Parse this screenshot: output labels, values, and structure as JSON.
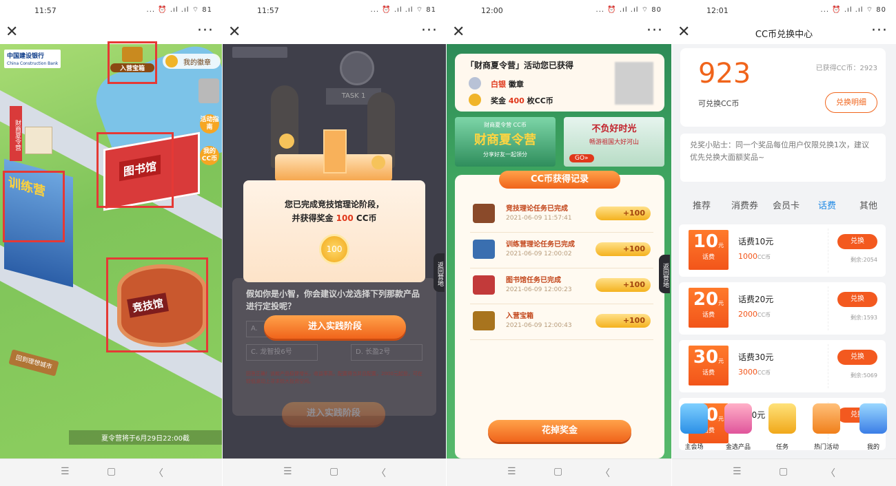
{
  "panels": [
    {
      "time": "11:57",
      "status_icons": "... ⏰ .ıl .ıl ⌔ 81"
    },
    {
      "time": "11:57",
      "status_icons": "... ⏰ .ıl .ıl ⌔ 81"
    },
    {
      "time": "12:00",
      "status_icons": "... ⏰ .ıl .ıl ⌔ 80"
    },
    {
      "time": "12:01",
      "status_icons": "... ⏰ .ıl .ıl ⌔ 80"
    }
  ],
  "p1": {
    "bank_name": "中国建设银行",
    "bank_name_en": "China Construction Bank",
    "entry_box": "入营宝箱",
    "my_badge": "我的徽章",
    "guide": "活动指南",
    "my_cc": "我的CC币",
    "camp_sign": "财商夏令营",
    "training": "训练营",
    "library": "图书馆",
    "arena": "竞技馆",
    "return_city": "回到理想城市",
    "notice": "夏令营将于6月29日22:00截"
  },
  "p2": {
    "task_board": "TASK 1",
    "modal_line1": "您已完成竞技馆理论阶段，",
    "modal_line2_pre": "并获得奖金 ",
    "modal_amount": "100",
    "modal_line2_post": " CC币",
    "coin_value": "100",
    "question": "假如你是小智，你会建议小龙选择下列那款产品进行定投呢？",
    "option_a": "A.",
    "option_c": "C. 龙智投6号",
    "option_d": "D. 长盈2号",
    "hint": "回答正确！该款产品稳健增长，收益率高，配置得当并且配置，2000元起投，可在较低波动上寻求较大投资空间。",
    "enter_btn": "进入实践阶段",
    "enter_btn_faded": "进入实践阶段",
    "side_tab": "返回营地"
  },
  "p3": {
    "earned_title": "「财商夏令营」活动您已获得",
    "badge_label": "白银",
    "badge_suffix": "徽章",
    "bonus_label": "奖金",
    "bonus_amount": "400",
    "bonus_suffix": "枚CC币",
    "banner1_top": "财商夏令营 CC币",
    "banner1_title": "财商夏令营",
    "banner1_sub": "分享好友一起领分",
    "banner2_title": "不负好时光",
    "banner2_sub": "畅游祖国大好河山",
    "banner2_go": "GO»",
    "records_title": "CC币获得记录",
    "records": [
      {
        "title": "竞技理论任务已完成",
        "date": "2021-06-09 11:57:41",
        "amount": "+100"
      },
      {
        "title": "训练营理论任务已完成",
        "date": "2021-06-09 12:00:02",
        "amount": "+100"
      },
      {
        "title": "图书馆任务已完成",
        "date": "2021-06-09 12:00:23",
        "amount": "+100"
      },
      {
        "title": "入营宝箱",
        "date": "2021-06-09 12:00:43",
        "amount": "+100"
      }
    ],
    "spend_btn": "花掉奖金",
    "side_tab": "返回营地"
  },
  "p4": {
    "title": "CC币兑换中心",
    "balance": "923",
    "earned_label": "已获得CC币：2923",
    "balance_label": "可兑换CC币",
    "detail_btn": "兑换明细",
    "tip": "兑奖小贴士：同一个奖品每位用户仅限兑换1次，建议优先兑换大面额奖品~",
    "tabs": [
      "推荐",
      "消费券",
      "会员卡",
      "话费",
      "其他"
    ],
    "active_tab": 3,
    "prizes": [
      {
        "face": "10",
        "unit": "元",
        "tag": "话费",
        "name": "话费10元",
        "price": "1000",
        "price_unit": "CC币",
        "btn": "兑换",
        "left": "剩余:2054"
      },
      {
        "face": "20",
        "unit": "元",
        "tag": "话费",
        "name": "话费20元",
        "price": "2000",
        "price_unit": "CC币",
        "btn": "兑换",
        "left": "剩余:1593"
      },
      {
        "face": "30",
        "unit": "元",
        "tag": "话费",
        "name": "话费30元",
        "price": "3000",
        "price_unit": "CC币",
        "btn": "兑换",
        "left": "剩余:5069"
      },
      {
        "face": "50",
        "unit": "元",
        "tag": "话费",
        "name": "费50元",
        "btn": "兑换"
      }
    ],
    "dock": [
      "主会场",
      "金选产品",
      "任务",
      "热门活动",
      "我的"
    ]
  },
  "colors": {
    "accent_orange": "#f3591f",
    "red_box": "#e53935",
    "ccb_blue": "#0b3a88"
  }
}
